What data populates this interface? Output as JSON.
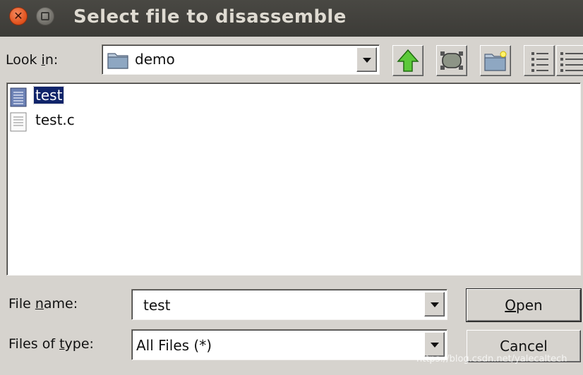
{
  "window": {
    "title": "Select file to disassemble"
  },
  "lookin": {
    "label_pre": "Look ",
    "label_accel": "i",
    "label_post": "n:",
    "value": "demo"
  },
  "toolbar": {
    "icons": [
      "up-folder-icon",
      "home-icon",
      "new-folder-icon",
      "list-view-icon",
      "details-view-icon"
    ]
  },
  "files": [
    {
      "name": "test",
      "selected": true,
      "icon": "executable-file-icon"
    },
    {
      "name": "test.c",
      "selected": false,
      "icon": "text-file-icon"
    }
  ],
  "filename": {
    "label_pre": "File ",
    "label_accel": "n",
    "label_post": "ame:",
    "value": "test"
  },
  "filetype": {
    "label_pre": "Files of ",
    "label_accel": "t",
    "label_post": "ype:",
    "value": "All Files (*)"
  },
  "buttons": {
    "open_accel": "O",
    "open_rest": "pen",
    "cancel": "Cancel"
  },
  "watermark": "https://blog.csdn.net/yalecaltech",
  "colors": {
    "titlebar": "#3c3b37",
    "close": "#e2531e",
    "selection": "#10246a",
    "up_arrow": "#3cae1f"
  }
}
